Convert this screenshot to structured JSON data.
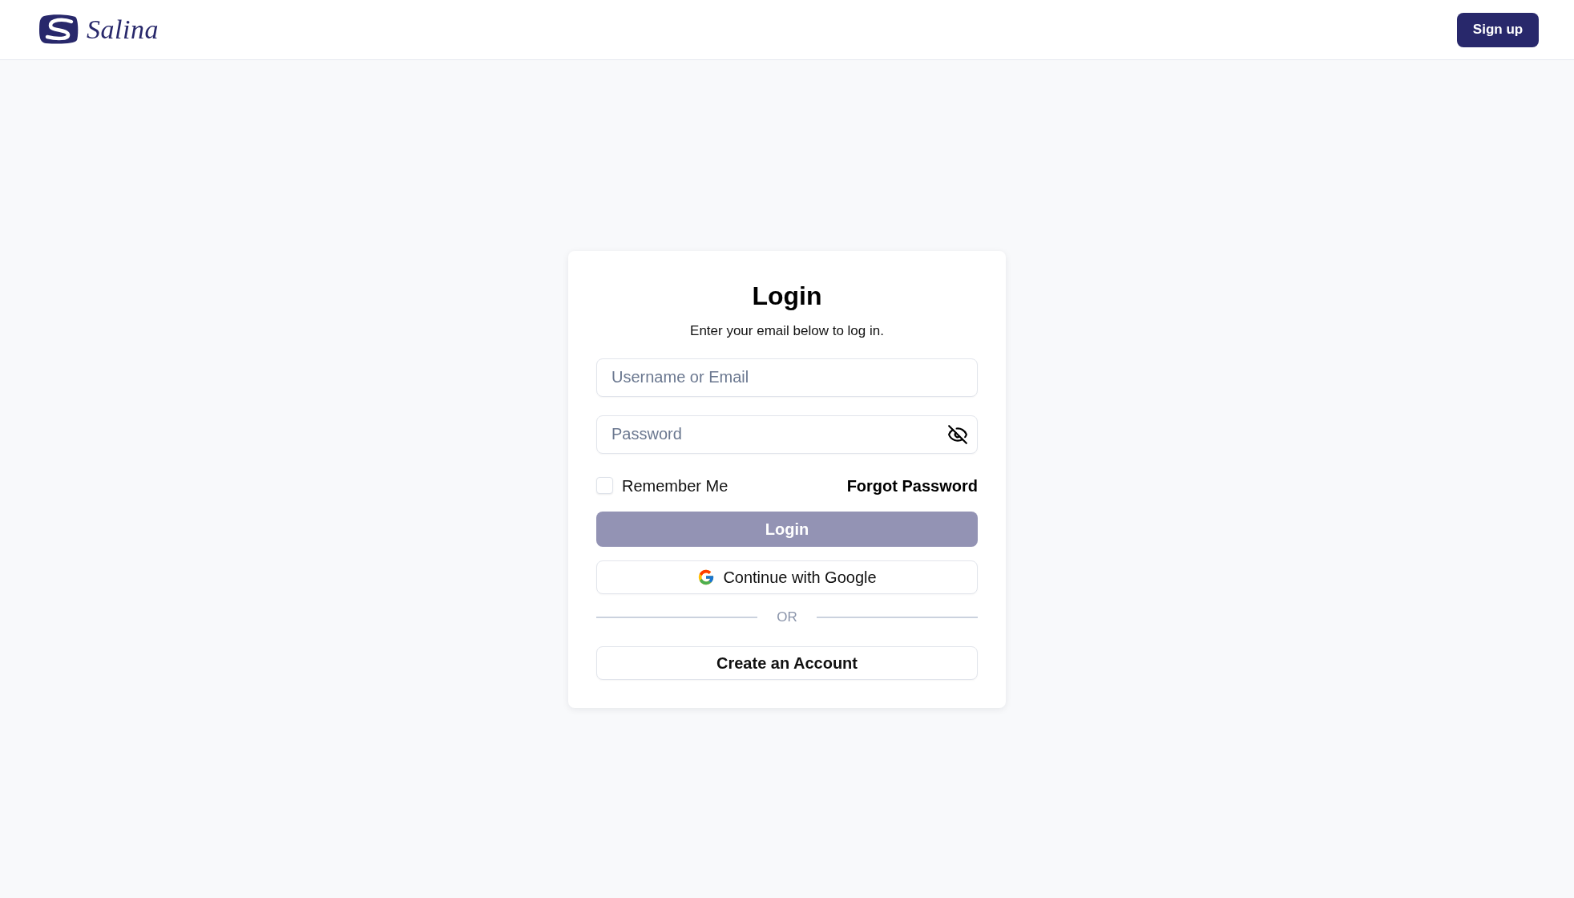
{
  "header": {
    "logo": {
      "text": "Salina"
    },
    "signup_button": {
      "label": "Sign up"
    }
  },
  "login_card": {
    "title": "Login",
    "subtitle": "Enter your email below to log in.",
    "fields": [
      {
        "kind": "text",
        "placeholder": "Username or Email"
      },
      {
        "kind": "password",
        "placeholder": "Password",
        "password_visible": false
      }
    ],
    "remember_me": {
      "label": "Remember Me",
      "checked": false
    },
    "forgot_password_link": "Forgot Password",
    "login_button": {
      "label": "Login",
      "disabled": true
    },
    "google_button": {
      "label": "Continue with Google"
    },
    "divider_text": "OR",
    "create_account_button": {
      "label": "Create an Account"
    }
  }
}
